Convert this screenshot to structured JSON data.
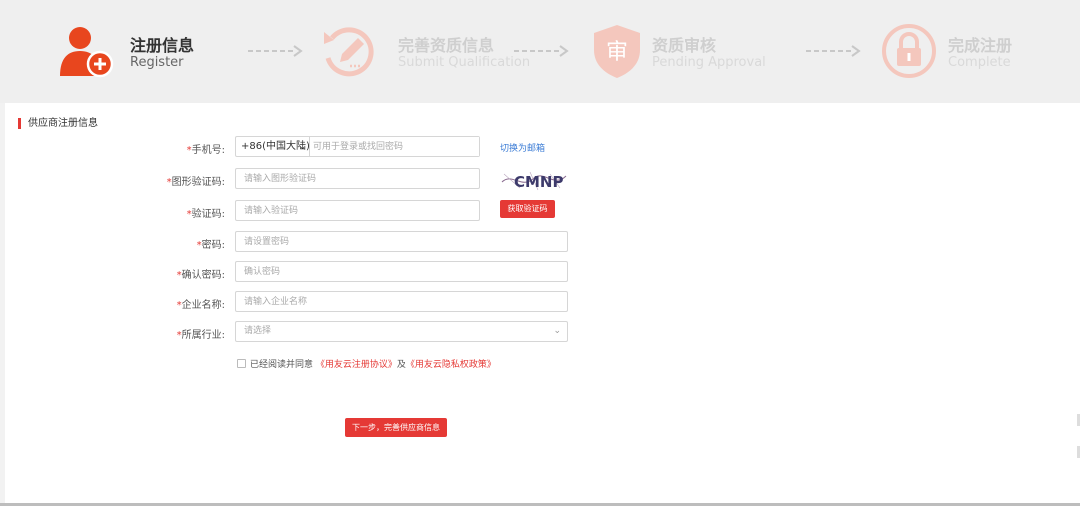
{
  "steps": [
    {
      "title": "注册信息",
      "subtitle": "Register",
      "icon": "user-add-icon"
    },
    {
      "title": "完善资质信息",
      "subtitle": "Submit Qualification",
      "icon": "edit-refresh-icon"
    },
    {
      "title": "资质审核",
      "subtitle": "Pending Approval",
      "icon": "shield-review-icon"
    },
    {
      "title": "完成注册",
      "subtitle": "Complete",
      "icon": "lock-icon"
    }
  ],
  "colors": {
    "accent": "#e53935",
    "step_inactive": "#f4c7bd",
    "link": "#3a7bd5"
  },
  "section_title": "供应商注册信息",
  "form": {
    "phone": {
      "required": "*",
      "label": "手机号:",
      "country": "+86(中国大陆)",
      "placeholder": "可用于登录或找回密码",
      "switch_link": "切换为邮箱"
    },
    "captcha": {
      "required": "*",
      "label": "图形验证码:",
      "placeholder": "请输入图形验证码",
      "image_text": "CMNP"
    },
    "sms": {
      "required": "*",
      "label": "验证码:",
      "placeholder": "请输入验证码",
      "button": "获取验证码"
    },
    "password": {
      "required": "*",
      "label": "密码:",
      "placeholder": "请设置密码"
    },
    "confirm": {
      "required": "*",
      "label": "确认密码:",
      "placeholder": "确认密码"
    },
    "company": {
      "required": "*",
      "label": "企业名称:",
      "placeholder": "请输入企业名称"
    },
    "industry": {
      "required": "*",
      "label": "所属行业:",
      "placeholder": "请选择"
    }
  },
  "agreement": {
    "prefix": "已经阅读并同意",
    "link1": "《用友云注册协议》",
    "middle": "及",
    "link2": "《用友云隐私权政策》"
  },
  "next_button": "下一步，完善供应商信息"
}
